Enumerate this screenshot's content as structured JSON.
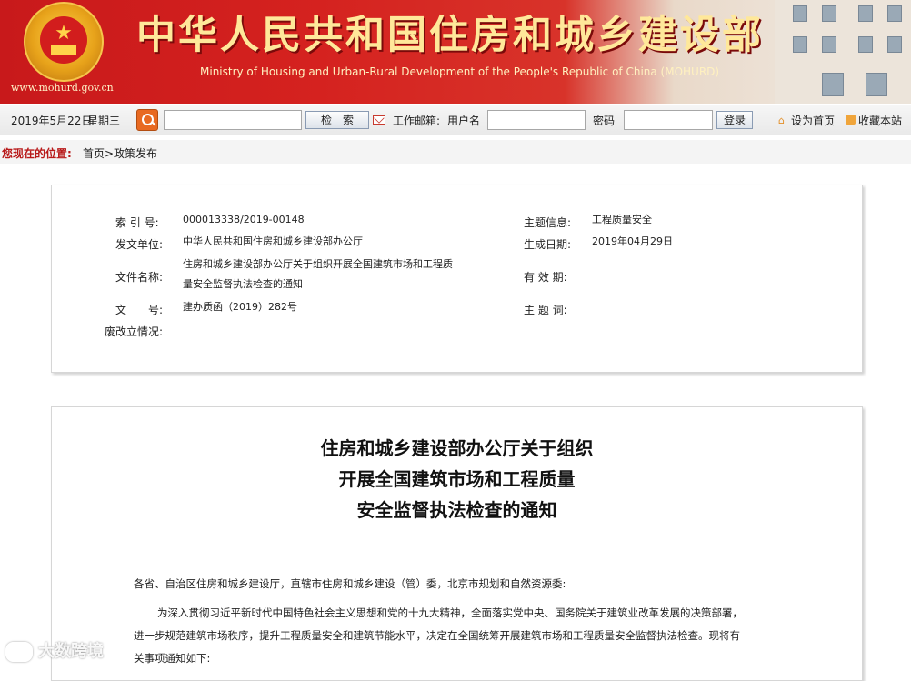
{
  "header": {
    "site_title": "中华人民共和国住房和城乡建设部",
    "site_title_en": "Ministry of Housing and Urban-Rural Development of the People's Republic of China (MOHURD)",
    "site_url": "www.mohurd.gov.cn",
    "emblem_icon": "national-emblem"
  },
  "toolbar": {
    "date": "2019年5月22日",
    "weekday": "星期三",
    "search_placeholder": "",
    "search_button": "检　索",
    "mail_label": "工作邮箱:",
    "username_label": "用户名",
    "password_label": "密码",
    "login_button": "登录",
    "set_home": "设为首页",
    "bookmark": "收藏本站"
  },
  "breadcrumb": {
    "label": "您现在的位置:",
    "path": "首页>政策发布"
  },
  "meta": {
    "index_label": "索 引 号:",
    "index_value": "000013338/2019-00148",
    "issuer_label": "发文单位:",
    "issuer_value": "中华人民共和国住房和城乡建设部办公厅",
    "filename_label": "文件名称:",
    "filename_value": "住房和城乡建设部办公厅关于组织开展全国建筑市场和工程质量安全监督执法检查的通知",
    "docno_label": "文　　号:",
    "docno_value": "建办质函（2019）282号",
    "repeal_label": "废改立情况:",
    "repeal_value": "",
    "topic_label": "主题信息:",
    "topic_value": "工程质量安全",
    "date_label": "生成日期:",
    "date_value": "2019年04月29日",
    "validity_label": "有 效 期:",
    "validity_value": "",
    "keywords_label": "主 题 词:",
    "keywords_value": ""
  },
  "document": {
    "title_line1": "住房和城乡建设部办公厅关于组织",
    "title_line2": "开展全国建筑市场和工程质量",
    "title_line3": "安全监督执法检查的通知",
    "salutation": "各省、自治区住房和城乡建设厅，直辖市住房和城乡建设（管）委，北京市规划和自然资源委:",
    "para1_line1": "为深入贯彻习近平新时代中国特色社会主义思想和党的十九大精神，全面落实党中央、国务院关于建筑业改革发展的决策部署，",
    "para1_line2": "进一步规范建筑市场秩序，提升工程质量安全和建筑节能水平，决定在全国统筹开展建筑市场和工程质量安全监督执法检查。现将有",
    "para1_line3": "关事项通知如下:"
  },
  "watermark": {
    "text": "大数跨境"
  },
  "colors": {
    "banner_red": "#c8191b",
    "title_gold": "#ffe89a",
    "breadcrumb_red": "#b81919"
  }
}
